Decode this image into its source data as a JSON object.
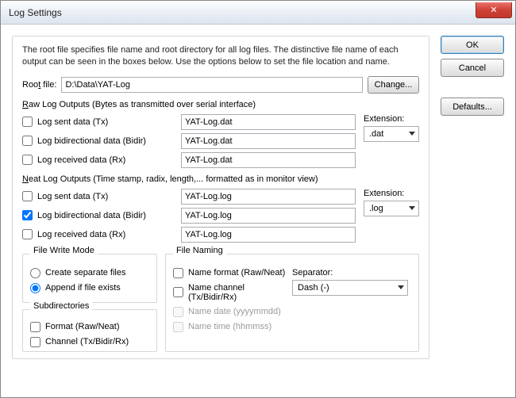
{
  "window": {
    "title": "Log Settings"
  },
  "buttons": {
    "ok": "OK",
    "cancel": "Cancel",
    "defaults": "Defaults...",
    "change": "Change...",
    "close_x": "✕"
  },
  "description": "The root file specifies file name and root directory for all log files. The distinctive file name of each output can be seen in the boxes below. Use the options below to set the file location and name.",
  "root": {
    "label_pre": "Roo",
    "label_u": "t",
    "label_post": " file:",
    "value": "D:\\Data\\YAT-Log"
  },
  "raw": {
    "title_u": "R",
    "title_rest": "aw Log Outputs (Bytes as transmitted over serial interface)",
    "sent": {
      "label": "Log sent data (Tx)",
      "file": "YAT-Log.dat",
      "checked": false
    },
    "bidir": {
      "label": "Log bidirectional data (Bidir)",
      "file": "YAT-Log.dat",
      "checked": false
    },
    "recv": {
      "label": "Log received data (Rx)",
      "file": "YAT-Log.dat",
      "checked": false
    },
    "ext_label": "Extension:",
    "ext_value": ".dat"
  },
  "neat": {
    "title_u": "N",
    "title_rest": "eat Log Outputs (Time stamp, radix, length,... formatted as in monitor view)",
    "sent": {
      "label": "Log sent data (Tx)",
      "file": "YAT-Log.log",
      "checked": false
    },
    "bidir": {
      "label": "Log bidirectional data (Bidir)",
      "file": "YAT-Log.log",
      "checked": true
    },
    "recv": {
      "label": "Log received data (Rx)",
      "file": "YAT-Log.log",
      "checked": false
    },
    "ext_label": "Extension:",
    "ext_value": ".log"
  },
  "filewrite": {
    "legend": "File Write Mode",
    "separate": "Create separate files",
    "append": "Append if file exists",
    "selected": "append"
  },
  "subdirs": {
    "legend": "Subdirectories",
    "format": "Format (Raw/Neat)",
    "channel": "Channel (Tx/Bidir/Rx)"
  },
  "naming": {
    "legend": "File Naming",
    "format": "Name format (Raw/Neat)",
    "channel": "Name channel (Tx/Bidir/Rx)",
    "date": "Name date (yyyymmdd)",
    "time": "Name time (hhmmss)",
    "sep_label": "Separator:",
    "sep_value": "Dash (-)"
  }
}
